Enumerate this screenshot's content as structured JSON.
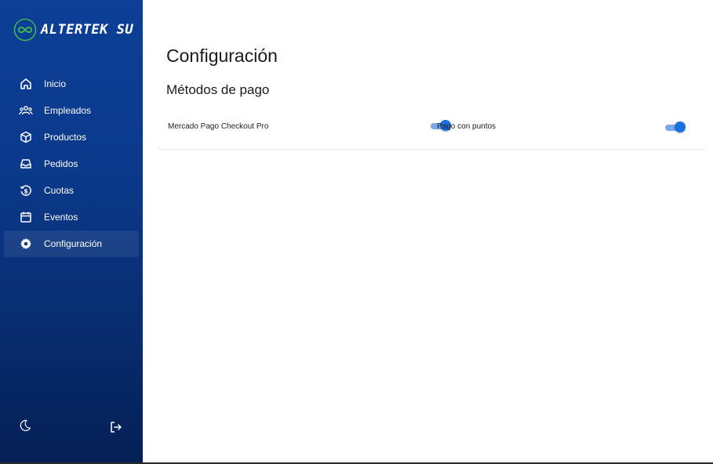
{
  "brand": {
    "logo_text": "ALTERTEK SU",
    "logo_icon": "infinity-logo-icon",
    "accent_color": "#3fb34f"
  },
  "sidebar": {
    "items": [
      {
        "label": "Inicio",
        "icon": "home-icon"
      },
      {
        "label": "Empleados",
        "icon": "users-icon"
      },
      {
        "label": "Productos",
        "icon": "cube-icon"
      },
      {
        "label": "Pedidos",
        "icon": "inbox-icon"
      },
      {
        "label": "Cuotas",
        "icon": "dollar-cycle-icon"
      },
      {
        "label": "Eventos",
        "icon": "calendar-icon"
      },
      {
        "label": "Configuración",
        "icon": "gear-icon",
        "active": true
      }
    ],
    "bottom": {
      "theme_icon": "moon-icon",
      "logout_icon": "logout-icon"
    },
    "background_color": "#0b3a8c"
  },
  "main": {
    "title": "Configuración",
    "section_title": "Métodos de pago",
    "payment_methods": [
      {
        "label": "Mercado Pago Checkout Pro",
        "enabled": true
      },
      {
        "label": "Pago con puntos",
        "enabled": true
      }
    ],
    "toggle_color": "#1a6fe0"
  }
}
